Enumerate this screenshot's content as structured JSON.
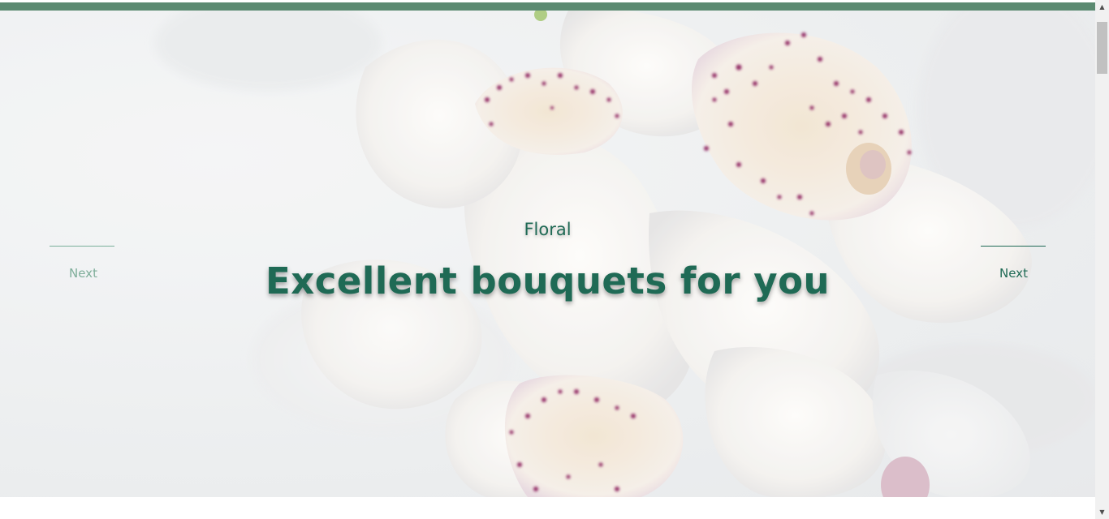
{
  "hero": {
    "eyebrow": "Floral",
    "headline": "Excellent bouquets for you",
    "background_image": "white-orchids-photo"
  },
  "slider": {
    "prev_label": "Next",
    "next_label": "Next"
  },
  "colors": {
    "accent": "#5b8a71",
    "text_primary": "#1f6a55",
    "text_muted": "#7fae9a"
  },
  "scrollbar": {
    "up_glyph": "▲",
    "down_glyph": "▼"
  }
}
